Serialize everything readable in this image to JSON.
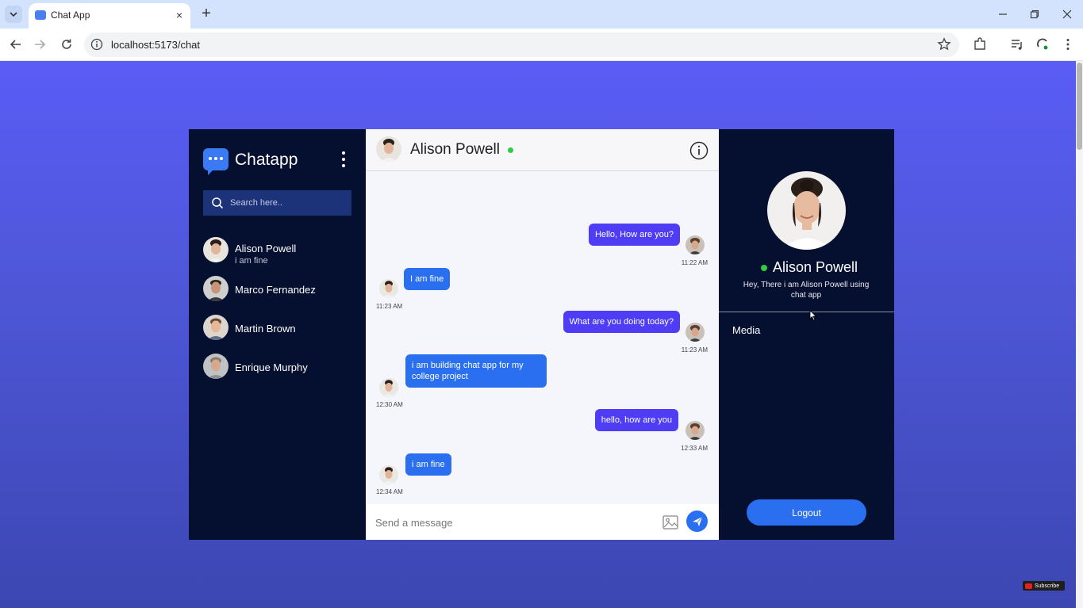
{
  "browser": {
    "tab_title": "Chat App",
    "url": "localhost:5173/chat",
    "new_tab_symbol": "+",
    "close_symbol": "×"
  },
  "sidebar": {
    "app_name": "Chatapp",
    "search_placeholder": "Search here..",
    "contacts": [
      {
        "name": "Alison Powell",
        "last_message": "i am fine"
      },
      {
        "name": "Marco Fernandez",
        "last_message": ""
      },
      {
        "name": "Martin Brown",
        "last_message": ""
      },
      {
        "name": "Enrique Murphy",
        "last_message": ""
      }
    ]
  },
  "chat": {
    "contact_name": "Alison Powell",
    "status": "online",
    "messages": [
      {
        "direction": "sent",
        "text": "Hello, How are you?",
        "time": "11:22 AM"
      },
      {
        "direction": "received",
        "text": "I am fine",
        "time": "11:23 AM"
      },
      {
        "direction": "sent",
        "text": "What are you doing today?",
        "time": "11:23 AM"
      },
      {
        "direction": "received",
        "text": "i am building chat app for my college project",
        "time": "12:30 AM"
      },
      {
        "direction": "sent",
        "text": "hello, how are you",
        "time": "12:33 AM"
      },
      {
        "direction": "received",
        "text": "i am fine",
        "time": "12:34 AM"
      }
    ],
    "composer_placeholder": "Send a message"
  },
  "profile": {
    "name": "Alison Powell",
    "bio": "Hey, There i am Alison Powell using chat app",
    "media_label": "Media",
    "logout_label": "Logout"
  },
  "overlay": {
    "subscribe_label": "Subscribe"
  },
  "colors": {
    "page_gradient_top": "#5a5cf6",
    "sidebar_bg": "#050f30",
    "sent_bubble": "#4e3df4",
    "received_bubble": "#2a6ff0",
    "online": "#2ecc40"
  }
}
